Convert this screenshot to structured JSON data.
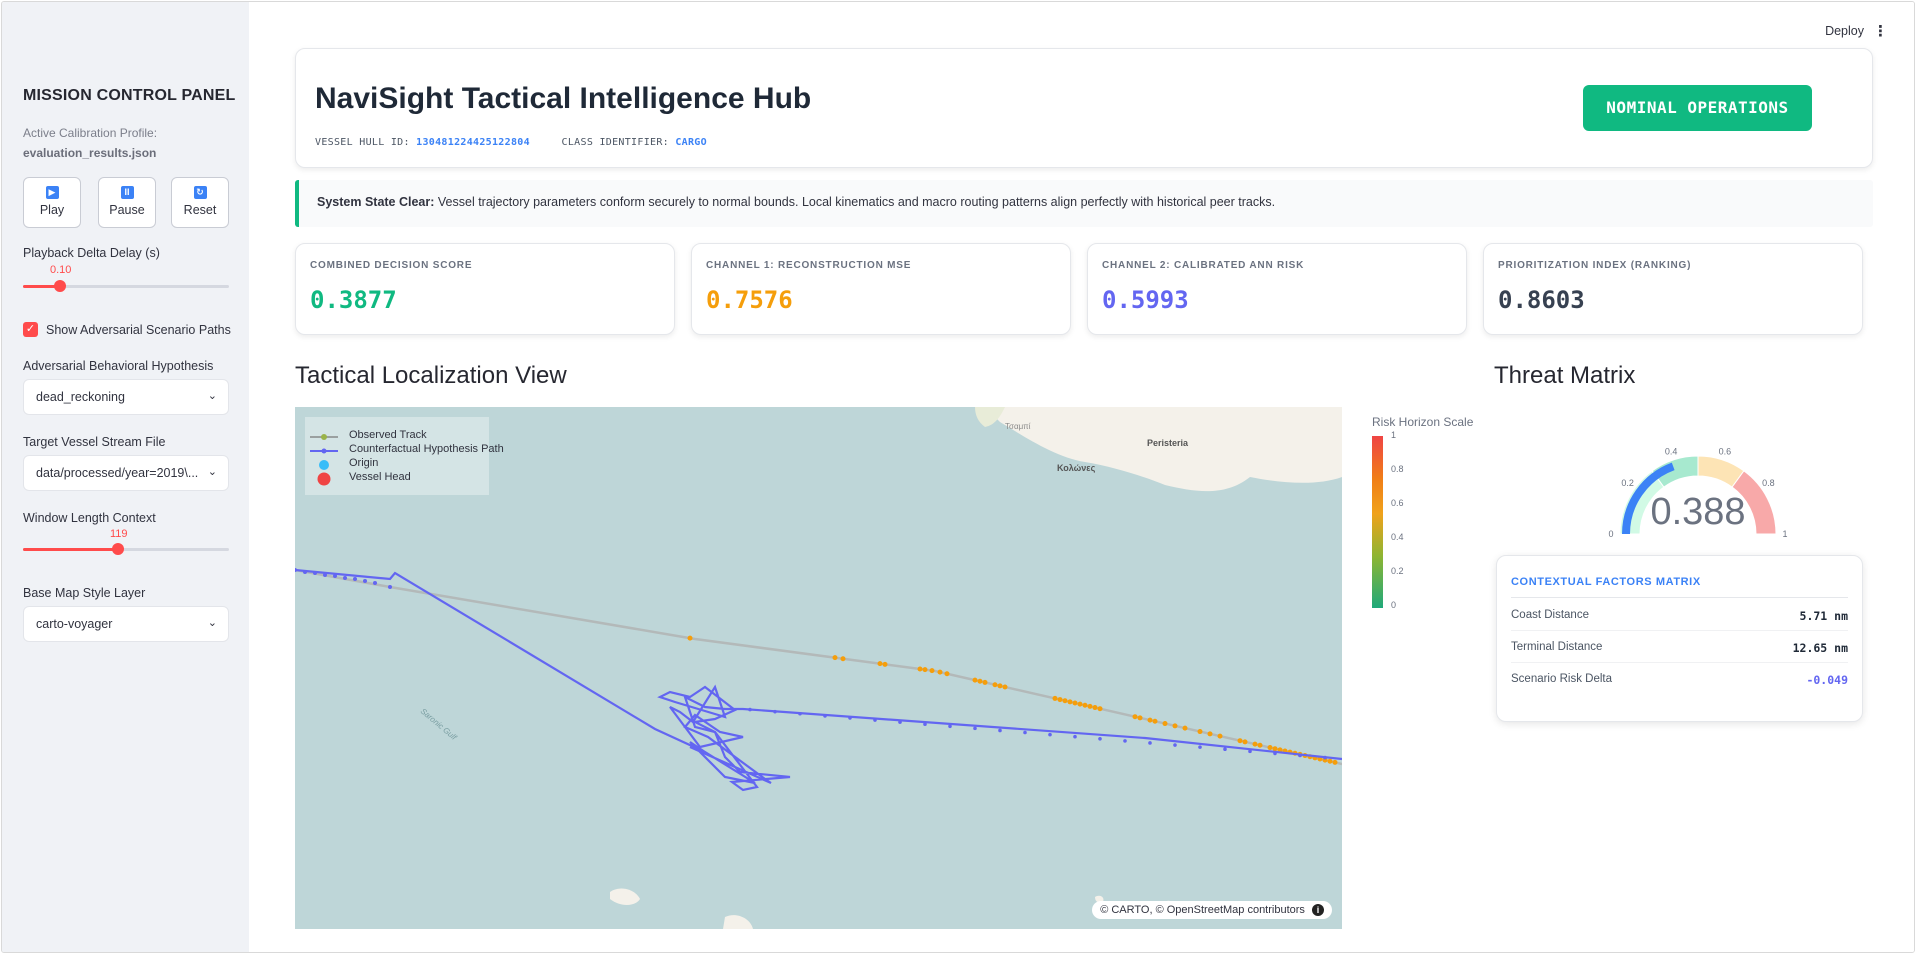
{
  "topbar": {
    "deploy_label": "Deploy",
    "menu_icon": "kebab-menu-icon"
  },
  "sidebar": {
    "title": "MISSION CONTROL PANEL",
    "calibration_label": "Active Calibration Profile:",
    "calibration_file": "evaluation_results.json",
    "buttons": [
      {
        "label": "Play",
        "icon": "play-icon"
      },
      {
        "label": "Pause",
        "icon": "pause-icon"
      },
      {
        "label": "Reset",
        "icon": "reset-icon"
      }
    ],
    "playback": {
      "label": "Playback Delta Delay (s)",
      "value": "0.10",
      "fraction": 0.18
    },
    "adversarial_checkbox": {
      "label": "Show Adversarial Scenario Paths",
      "checked": true
    },
    "hypothesis": {
      "label": "Adversarial Behavioral Hypothesis",
      "value": "dead_reckoning"
    },
    "stream": {
      "label": "Target Vessel Stream File",
      "value": "data/processed/year=2019\\..."
    },
    "window": {
      "label": "Window Length Context",
      "value": "119",
      "fraction": 0.46
    },
    "basemap": {
      "label": "Base Map Style Layer",
      "value": "carto-voyager"
    }
  },
  "header": {
    "title": "NaviSight Tactical Intelligence Hub",
    "hull_label": "VESSEL HULL ID:",
    "hull_value": "130481224425122804",
    "class_label": "CLASS IDENTIFIER:",
    "class_value": "CARGO",
    "status": "NOMINAL OPERATIONS",
    "status_color": "#10b981"
  },
  "state_banner": {
    "bold": "System State Clear:",
    "text": " Vessel trajectory parameters conform securely to normal bounds. Local kinematics and macro routing patterns align perfectly with historical peer tracks."
  },
  "metrics": [
    {
      "label": "COMBINED DECISION SCORE",
      "value": "0.3877",
      "color": "#10b981"
    },
    {
      "label": "CHANNEL 1: RECONSTRUCTION MSE",
      "value": "0.7576",
      "color": "#f59e0b"
    },
    {
      "label": "CHANNEL 2: CALIBRATED ANN RISK",
      "value": "0.5993",
      "color": "#6366f1"
    },
    {
      "label": "PRIORITIZATION INDEX (RANKING)",
      "value": "0.8603",
      "color": "#374151"
    }
  ],
  "map_section": {
    "title": "Tactical Localization View",
    "legend": [
      "Observed Track",
      "Counterfactual Hypothesis Path",
      "Origin",
      "Vessel Head"
    ],
    "places": [
      "Τσαμπί",
      "Peristeria",
      "Κολώνες",
      "Saronic Gulf"
    ],
    "attribution": "© CARTO, © OpenStreetMap contributors",
    "colorbar_title": "Risk Horizon Scale",
    "colorbar_ticks": [
      "1",
      "0.8",
      "0.6",
      "0.4",
      "0.2",
      "0"
    ]
  },
  "threat": {
    "title": "Threat Matrix",
    "gauge_value": "0.388",
    "gauge_fraction": 0.388,
    "gauge_ticks": [
      "0",
      "0.2",
      "0.4",
      "0.6",
      "0.8",
      "1"
    ]
  },
  "context": {
    "title": "CONTEXTUAL FACTORS MATRIX",
    "rows": [
      {
        "key": "Coast Distance",
        "value": "5.71 nm",
        "color": "#1f2937"
      },
      {
        "key": "Terminal Distance",
        "value": "12.65 nm",
        "color": "#1f2937"
      },
      {
        "key": "Scenario Risk Delta",
        "value": "-0.049",
        "color": "#6366f1"
      }
    ]
  }
}
